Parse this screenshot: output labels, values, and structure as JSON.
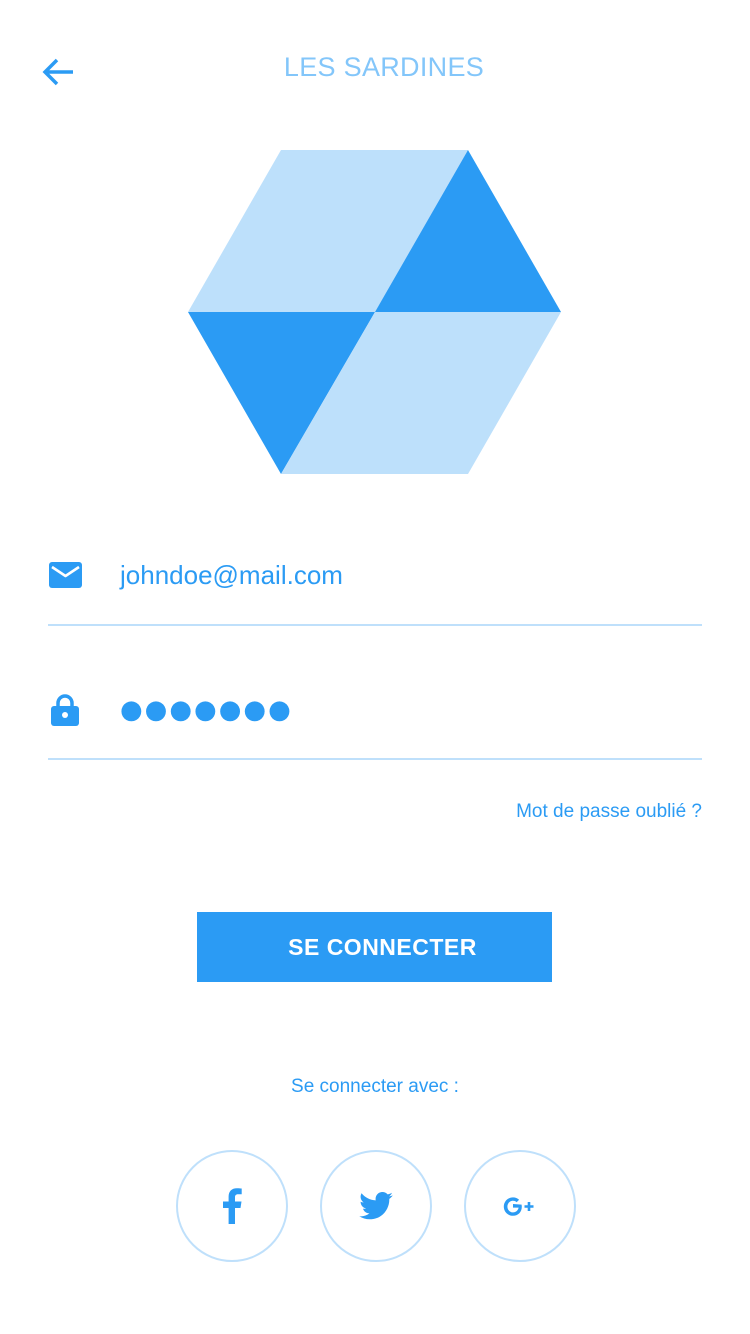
{
  "header": {
    "title": "LES SARDINES",
    "back_icon": "arrow-left-icon"
  },
  "logo": {
    "icon": "hexagon-cube-logo",
    "colors": {
      "light": "#bde0fb",
      "dark": "#2b9bf4"
    }
  },
  "form": {
    "email": {
      "icon": "envelope-icon",
      "value": "johndoe@mail.com"
    },
    "password": {
      "icon": "lock-icon",
      "value": "●●●●●●●"
    },
    "forgot_label": "Mot de passe oublié ?",
    "submit_label": "SE CONNECTER"
  },
  "social": {
    "caption": "Se connecter avec :",
    "providers": [
      {
        "name": "facebook",
        "icon": "facebook-icon"
      },
      {
        "name": "twitter",
        "icon": "twitter-icon"
      },
      {
        "name": "google-plus",
        "icon": "google-plus-icon",
        "label": "G+"
      }
    ]
  },
  "colors": {
    "accent": "#2b9bf4",
    "accent_light": "#83c6fa",
    "divider": "#bfe0fb",
    "background": "#ffffff"
  }
}
